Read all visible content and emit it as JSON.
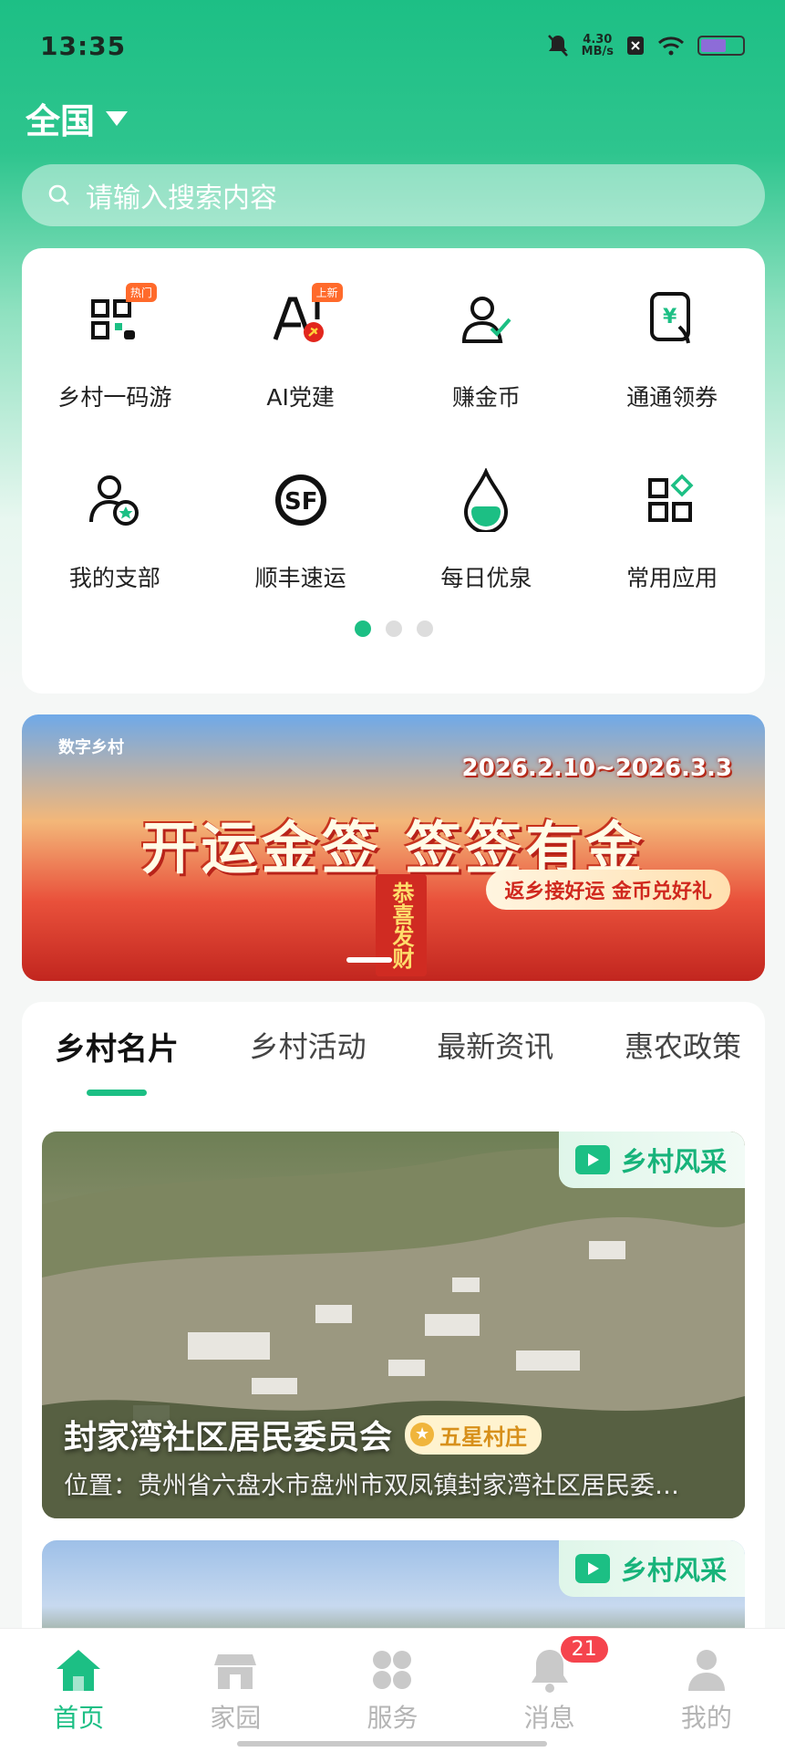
{
  "status": {
    "time": "13:35",
    "net_speed_top": "4.30",
    "net_speed_bottom": "MB/s"
  },
  "region": {
    "label": "全国"
  },
  "search": {
    "placeholder": "请输入搜索内容"
  },
  "grid": {
    "items": [
      {
        "label": "乡村一码游",
        "icon": "qr-code-icon",
        "badge": "热门"
      },
      {
        "label": "AI党建",
        "icon": "ai-party-icon",
        "badge": "上新"
      },
      {
        "label": "赚金币",
        "icon": "earn-coin-person-icon",
        "badge": ""
      },
      {
        "label": "通通领券",
        "icon": "coupon-hand-icon",
        "badge": ""
      },
      {
        "label": "我的支部",
        "icon": "branch-person-star-icon",
        "badge": ""
      },
      {
        "label": "顺丰速运",
        "icon": "sf-express-icon",
        "badge": ""
      },
      {
        "label": "每日优泉",
        "icon": "water-drop-icon",
        "badge": ""
      },
      {
        "label": "常用应用",
        "icon": "apps-grid-icon",
        "badge": ""
      }
    ]
  },
  "banner": {
    "logo": "数字乡村",
    "date_range": "2026.2.10~2026.3.3",
    "title": "开运金签  签签有金",
    "subtitle": "返乡接好运  金币兑好礼",
    "scroll_text": "恭喜发财"
  },
  "tabs": [
    {
      "label": "乡村名片",
      "active": true
    },
    {
      "label": "乡村活动",
      "active": false
    },
    {
      "label": "最新资讯",
      "active": false
    },
    {
      "label": "惠农政策",
      "active": false
    }
  ],
  "cards": [
    {
      "tag": "乡村风采",
      "title": "封家湾社区居民委员会",
      "rating": "五星村庄",
      "location": "位置：贵州省六盘水市盘州市双凤镇封家湾社区居民委…"
    },
    {
      "tag": "乡村风采"
    }
  ],
  "nav": [
    {
      "label": "首页",
      "icon": "home-icon",
      "active": true
    },
    {
      "label": "家园",
      "icon": "store-icon",
      "active": false
    },
    {
      "label": "服务",
      "icon": "services-icon",
      "active": false
    },
    {
      "label": "消息",
      "icon": "bell-icon",
      "active": false,
      "badge": "21"
    },
    {
      "label": "我的",
      "icon": "profile-icon",
      "active": false
    }
  ],
  "colors": {
    "accent": "#1cbf84",
    "badge_red": "#f5444d",
    "badge_orange": "#ff6a2b"
  }
}
